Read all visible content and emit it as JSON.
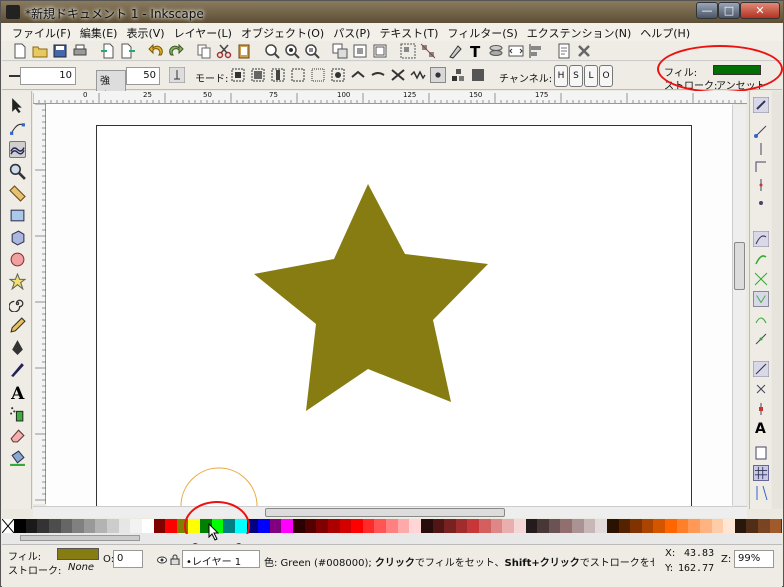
{
  "window": {
    "title": "*新規ドキュメント 1 - Inkscape",
    "min_glyph": "—",
    "max_glyph": "□",
    "close_glyph": "✕"
  },
  "menubar": [
    "ファイル(F)",
    "編集(E)",
    "表示(V)",
    "レイヤー(L)",
    "オブジェクト(O)",
    "パス(P)",
    "テキスト(T)",
    "フィルター(S)",
    "エクステンション(N)",
    "ヘルプ(H)"
  ],
  "controls": {
    "width_value": "10",
    "force_label": "強さ:",
    "force_value": "50",
    "mode_label": "モード:",
    "channel_label": "チャンネル:",
    "channels": [
      "H",
      "S",
      "L",
      "O"
    ]
  },
  "style_indicator": {
    "fill_label": "フィル:",
    "stroke_label": "ストローク:",
    "stroke_value": "アンセット",
    "fill_color": "#006e00"
  },
  "ruler": {
    "ticks": [
      "0",
      "25",
      "50",
      "75",
      "100",
      "125",
      "150",
      "175"
    ]
  },
  "canvas": {
    "star_color": "#867c12"
  },
  "palette": [
    "#000000",
    "#1a1a1a",
    "#333333",
    "#4d4d4d",
    "#666666",
    "#808080",
    "#999999",
    "#b3b3b3",
    "#cccccc",
    "#e6e6e6",
    "#f2f2f2",
    "#ffffff",
    "#800000",
    "#ff0000",
    "#808000",
    "#ffff00",
    "#008000",
    "#00ff00",
    "#008080",
    "#00ffff",
    "#000080",
    "#0000ff",
    "#800080",
    "#ff00ff",
    "#2b0000",
    "#550000",
    "#800000",
    "#aa0000",
    "#d40000",
    "#ff0000",
    "#ff2a2a",
    "#ff5555",
    "#ff8080",
    "#ffaaaa",
    "#ffd5d5",
    "#280b0b",
    "#501616",
    "#782121",
    "#a02c2c",
    "#c83737",
    "#d35f5f",
    "#de8787",
    "#e9afaf",
    "#f4d7d7",
    "#241c1c",
    "#483737",
    "#6c5353",
    "#916f6f",
    "#ac9393",
    "#c8b7b7",
    "#e3dbdb",
    "#2b1100",
    "#552200",
    "#803300",
    "#aa4400",
    "#d45500",
    "#ff6600",
    "#ff7f2a",
    "#ff9955",
    "#ffb380",
    "#ffccaa",
    "#ffe6d5",
    "#28170b",
    "#502d16",
    "#784421",
    "#a05a2c"
  ],
  "status": {
    "fill_label": "フィル:",
    "stroke_label": "ストローク:",
    "stroke_value": "None",
    "fill_color": "#867c12",
    "opacity_label": "O:",
    "opacity_value": "0",
    "layer_value": "•レイヤー 1",
    "message_prefix": "色: Green (#008000); ",
    "message_click": "クリック",
    "message_mid": "でフィルをセット、",
    "message_shift": "Shift+クリック",
    "message_end": "でストロークをセット…",
    "x_label": "X:",
    "x_value": "43.83",
    "y_label": "Y:",
    "y_value": "162.77",
    "z_label": "Z:",
    "zoom_value": "99%"
  }
}
